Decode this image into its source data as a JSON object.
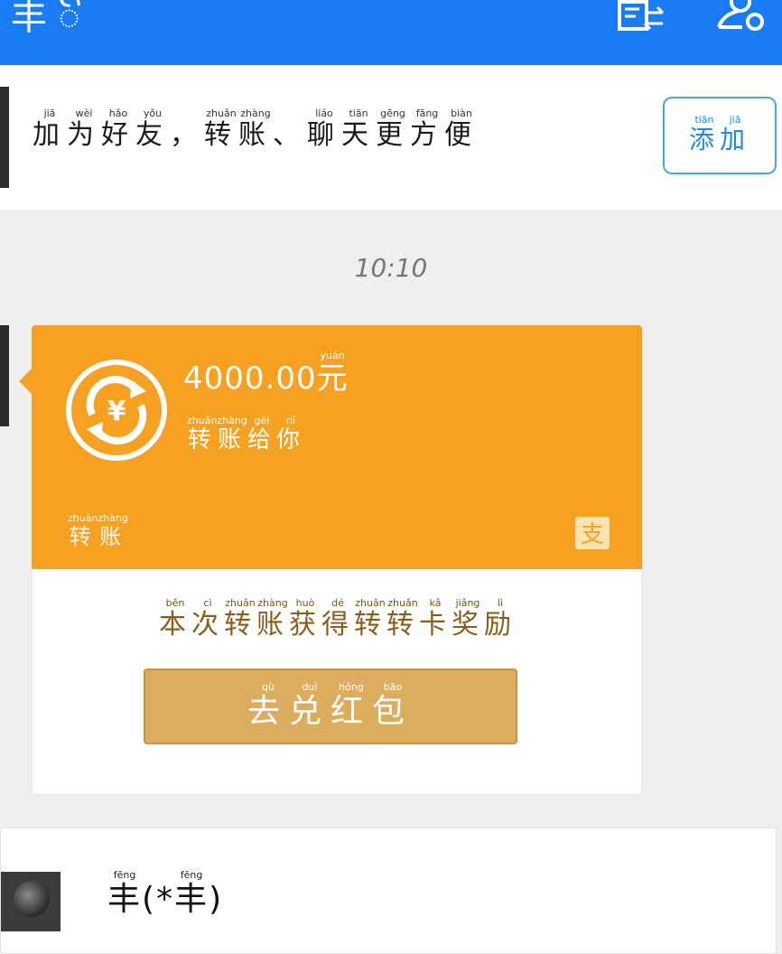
{
  "header": {
    "title": "丰 ꦼ",
    "icons": [
      "contacts-swap-icon",
      "person-settings-icon"
    ],
    "background_color": "#1a7cf2"
  },
  "banner": {
    "text_chars": [
      {
        "c": "加",
        "p": "jiā"
      },
      {
        "c": "为",
        "p": "wèi"
      },
      {
        "c": "好",
        "p": "hǎo"
      },
      {
        "c": "友",
        "p": "yǒu"
      },
      {
        "c": "，",
        "p": ""
      },
      {
        "c": "转",
        "p": "zhuǎn"
      },
      {
        "c": "账",
        "p": "zhàng"
      },
      {
        "c": "、",
        "p": ""
      },
      {
        "c": "聊",
        "p": "liáo"
      },
      {
        "c": "天",
        "p": "tiān"
      },
      {
        "c": "更",
        "p": "gēng"
      },
      {
        "c": "方",
        "p": "fāng"
      },
      {
        "c": "便",
        "p": "biàn"
      }
    ],
    "add_button": [
      {
        "c": "添",
        "p": "tiān"
      },
      {
        "c": "加",
        "p": "jiā"
      }
    ]
  },
  "timestamp": "10:10",
  "transfer": {
    "amount": "4000.00",
    "currency": {
      "c": "元",
      "p": "yuán"
    },
    "subtitle": [
      {
        "c": "转",
        "p": "zhuǎn"
      },
      {
        "c": "账",
        "p": "zhàng"
      },
      {
        "c": "给",
        "p": "gěi"
      },
      {
        "c": "你",
        "p": "nǐ"
      }
    ],
    "label": [
      {
        "c": "转",
        "p": "zhuǎn"
      },
      {
        "c": "账",
        "p": "zhàng"
      }
    ],
    "card_color": "#f7a122",
    "reward": [
      {
        "c": "本",
        "p": "běn"
      },
      {
        "c": "次",
        "p": "cì"
      },
      {
        "c": "转",
        "p": "zhuǎn"
      },
      {
        "c": "账",
        "p": "zhàng"
      },
      {
        "c": "获",
        "p": "huò"
      },
      {
        "c": "得",
        "p": "dé"
      },
      {
        "c": "转",
        "p": "zhuǎn"
      },
      {
        "c": "转",
        "p": "zhuǎn"
      },
      {
        "c": "卡",
        "p": "kǎ"
      },
      {
        "c": "奖",
        "p": "jiǎng"
      },
      {
        "c": "励",
        "p": "lì"
      }
    ],
    "redeem_button": [
      {
        "c": "去",
        "p": "qù"
      },
      {
        "c": "兑",
        "p": "duì"
      },
      {
        "c": "红",
        "p": "hóng"
      },
      {
        "c": "包",
        "p": "bāo"
      }
    ],
    "redeem_color": "#dcad5e"
  },
  "contact": {
    "name": [
      {
        "c": "丰",
        "p": "fēng"
      },
      {
        "c": "(",
        "p": ""
      },
      {
        "c": "*",
        "p": ""
      },
      {
        "c": "丰",
        "p": "fēng"
      },
      {
        "c": ")",
        "p": ""
      }
    ]
  }
}
